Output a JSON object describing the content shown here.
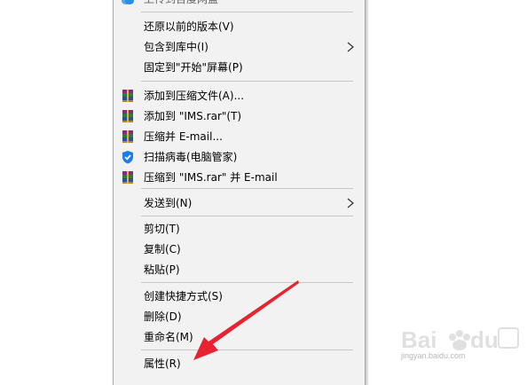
{
  "menu": {
    "items": [
      {
        "label": "上传到百度网盘",
        "icon": "baidu-netdisk-icon"
      },
      {
        "label": "还原以前的版本(V)"
      },
      {
        "label": "包含到库中(I)",
        "submenu": true
      },
      {
        "label": "固定到\"开始\"屏幕(P)"
      },
      {
        "label": "添加到压缩文件(A)...",
        "icon": "winrar-icon"
      },
      {
        "label": "添加到 \"IMS.rar\"(T)",
        "icon": "winrar-icon"
      },
      {
        "label": "压缩并 E-mail...",
        "icon": "winrar-icon"
      },
      {
        "label": "扫描病毒(电脑管家)",
        "icon": "tencent-shield-icon"
      },
      {
        "label": "压缩到 \"IMS.rar\" 并 E-mail",
        "icon": "winrar-icon"
      },
      {
        "label": "发送到(N)",
        "submenu": true
      },
      {
        "label": "剪切(T)"
      },
      {
        "label": "复制(C)"
      },
      {
        "label": "粘贴(P)"
      },
      {
        "label": "创建快捷方式(S)"
      },
      {
        "label": "删除(D)"
      },
      {
        "label": "重命名(M)"
      },
      {
        "label": "属性(R)"
      }
    ]
  },
  "watermark": {
    "text": "jingyan.baidu.com",
    "logo": "baidu-jingyan-logo"
  },
  "colors": {
    "menu_bg": "#f2f2f2",
    "separator": "#c8c8c8",
    "annotation_arrow": "#e8232f",
    "shield": "#1a7de8"
  }
}
